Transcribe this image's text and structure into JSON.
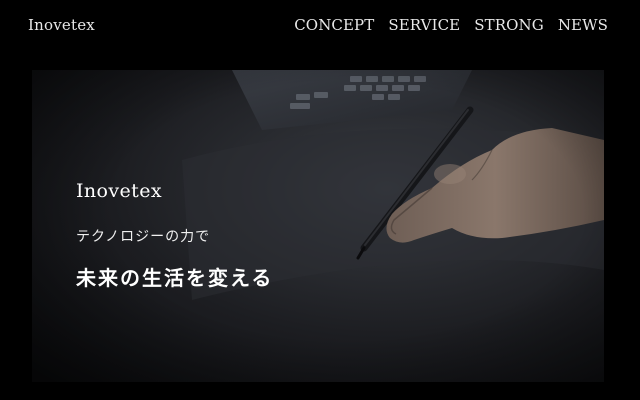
{
  "header": {
    "brand": "Inovetex",
    "nav": [
      {
        "label": "CONCEPT"
      },
      {
        "label": "SERVICE"
      },
      {
        "label": "STRONG"
      },
      {
        "label": "NEWS"
      }
    ]
  },
  "hero": {
    "brand": "Inovetex",
    "tagline": "テクノロジーの力で",
    "headline": "未来の生活を変える"
  },
  "colors": {
    "background": "#000000",
    "text": "#ffffff",
    "hero_dark": "#121316"
  }
}
